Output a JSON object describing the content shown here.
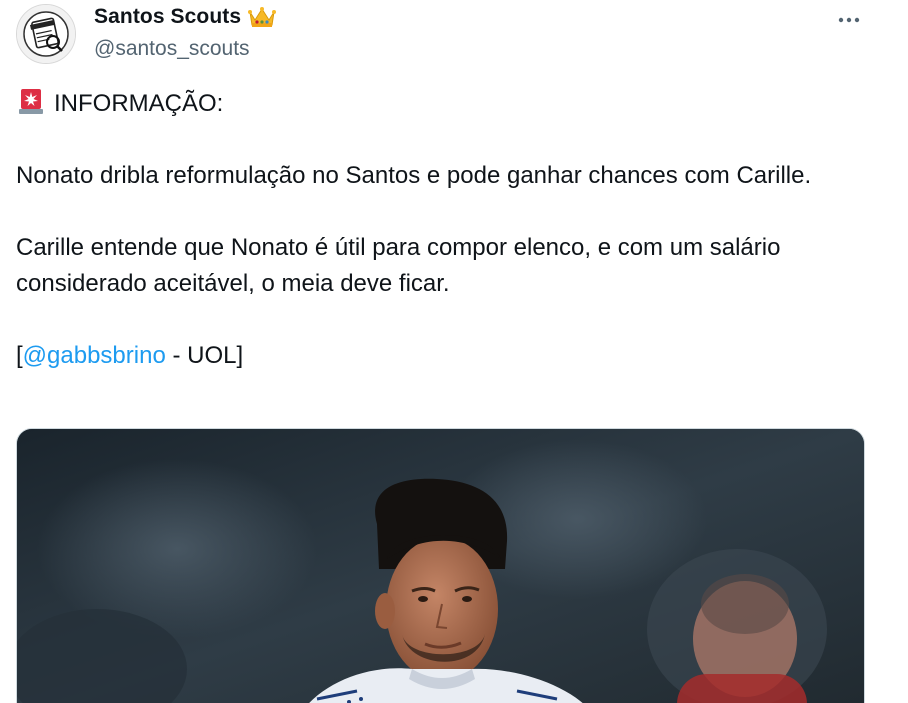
{
  "author": {
    "display_name": "Santos Scouts",
    "handle": "@santos_scouts",
    "badge_icon": "crown-emoji-icon",
    "avatar_icon": "santos-scouts-avatar-icon"
  },
  "menu": {
    "more_icon": "more-options-icon"
  },
  "tweet": {
    "alert_icon": "police-light-emoji-icon",
    "line1": "INFORMAÇÃO:",
    "para1": "Nonato dribla reformulação no Santos e pode ganhar chances com Carille.",
    "para2": "Carille entende que Nonato é útil para compor elenco, e com um salário considerado aceitável, o meia deve ficar.",
    "source_open": "[",
    "source_mention": "@gabbsbrino",
    "source_rest": " - UOL]"
  },
  "colors": {
    "text": "#0f1419",
    "secondary": "#536471",
    "link": "#1d9bf0"
  }
}
